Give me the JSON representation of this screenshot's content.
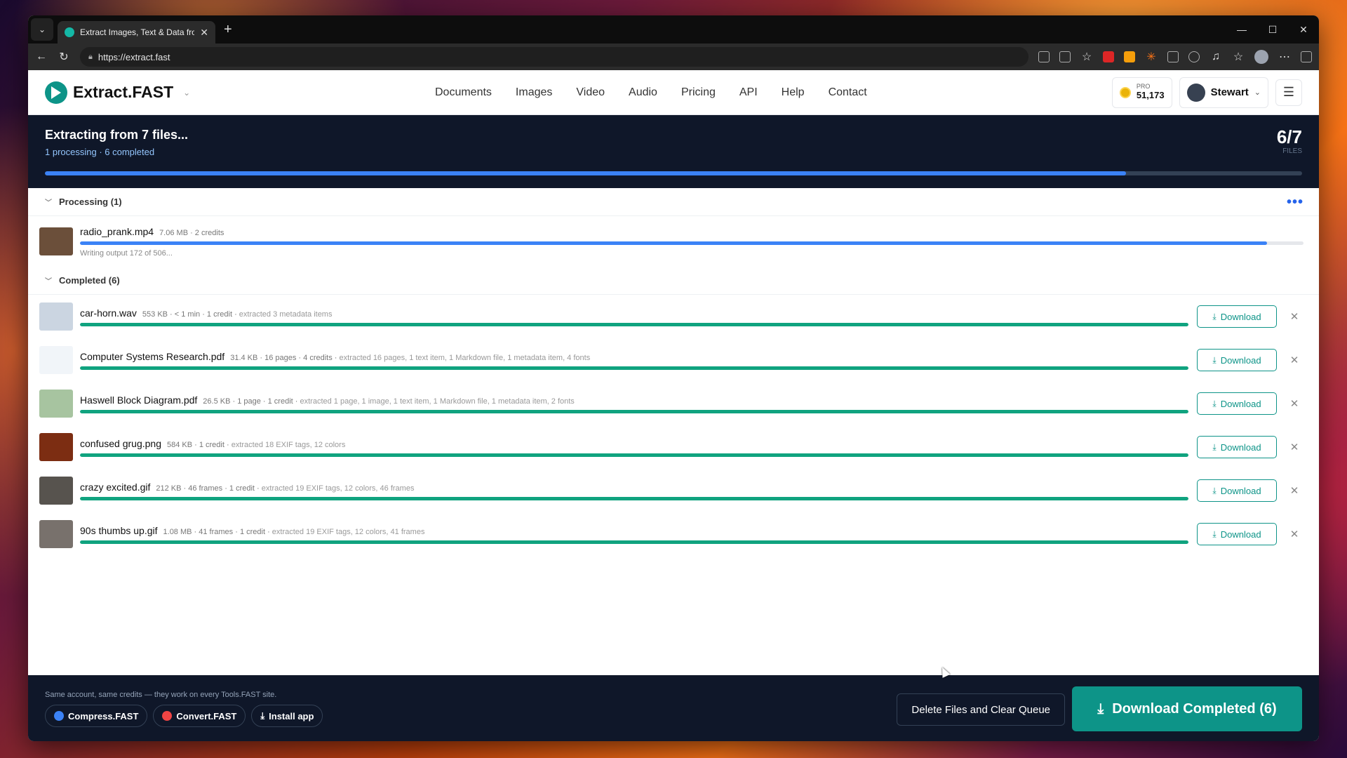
{
  "browser": {
    "tab_title": "Extract Images, Text & Data from A",
    "url": "https://extract.fast",
    "new_tab": "+",
    "close": "✕"
  },
  "site": {
    "logo_text": "Extract.FAST",
    "nav": [
      "Documents",
      "Images",
      "Video",
      "Audio",
      "Pricing",
      "API",
      "Help",
      "Contact"
    ],
    "credits_label": "PRO",
    "credits_value": "51,173",
    "user_name": "Stewart",
    "accent": "#0d9488"
  },
  "banner": {
    "title": "Extracting from 7 files...",
    "subtitle": "1 processing · 6 completed",
    "count": "6/7",
    "count_label": "FILES",
    "progress": 0.86
  },
  "processing": {
    "header": "Processing (1)",
    "items": [
      {
        "name": "radio_prank.mp4",
        "meta": "7.06 MB · 2 credits",
        "note": "Writing output 172 of 506...",
        "progress": 0.97,
        "thumb_color": "#6b4f3a"
      }
    ]
  },
  "completed": {
    "header": "Completed (6)",
    "download_label": "Download",
    "items": [
      {
        "name": "car-horn.wav",
        "meta": "553 KB · < 1 min · 1 credit ·",
        "extra": "extracted 3 metadata items",
        "thumb_color": "#cbd5e1"
      },
      {
        "name": "Computer Systems Research.pdf",
        "meta": "31.4 KB · 16 pages · 4 credits ·",
        "extra": "extracted 16 pages, 1 text item, 1 Markdown file, 1 metadata item, 4 fonts",
        "thumb_color": "#f1f5f9"
      },
      {
        "name": "Haswell Block Diagram.pdf",
        "meta": "26.5 KB · 1 page · 1 credit ·",
        "extra": "extracted 1 page, 1 image, 1 text item, 1 Markdown file, 1 metadata item, 2 fonts",
        "thumb_color": "#a7c4a0"
      },
      {
        "name": "confused grug.png",
        "meta": "584 KB · 1 credit ·",
        "extra": "extracted 18 EXIF tags, 12 colors",
        "thumb_color": "#7c2d12"
      },
      {
        "name": "crazy excited.gif",
        "meta": "212 KB · 46 frames · 1 credit ·",
        "extra": "extracted 19 EXIF tags, 12 colors, 46 frames",
        "thumb_color": "#57534e"
      },
      {
        "name": "90s thumbs up.gif",
        "meta": "1.08 MB · 41 frames · 1 credit ·",
        "extra": "extracted 19 EXIF tags, 12 colors, 41 frames",
        "thumb_color": "#78716c"
      }
    ]
  },
  "footer": {
    "tagline": "Same account, same credits — they work on every Tools.FAST site.",
    "sister_sites": [
      {
        "label": "Compress.FAST",
        "color": "#3b82f6"
      },
      {
        "label": "Convert.FAST",
        "color": "#ef4444"
      },
      {
        "label": "Install app",
        "color": ""
      }
    ],
    "clear_label": "Delete Files and Clear Queue",
    "download_all_label": "Download Completed (6)"
  }
}
